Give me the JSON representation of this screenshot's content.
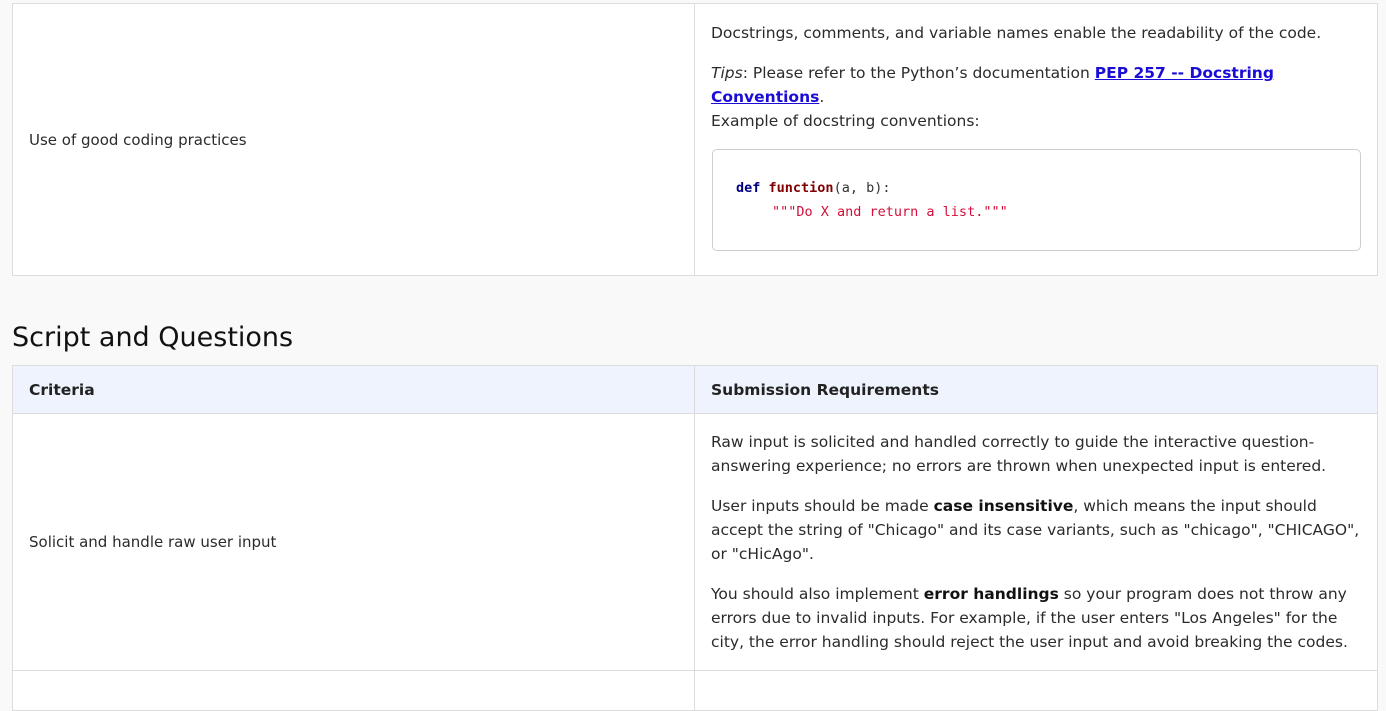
{
  "top_table": {
    "row": {
      "criteria": "Use of good coding practices",
      "req_p1": "Docstrings, comments, and variable names enable the readability of the code.",
      "tips_label": "Tips",
      "tips_text": ": Please refer to the Python’s documentation ",
      "tips_link": "PEP 257 -- Docstring Conventions",
      "tips_end": ".",
      "example_text": "Example of docstring conventions:",
      "code": {
        "def_kw": "def",
        "func_name": "function",
        "params": "(a, b):",
        "docstring": "\"\"\"Do X and return a list.\"\"\""
      }
    }
  },
  "section": {
    "title": "Script and Questions"
  },
  "script_table": {
    "headers": {
      "criteria": "Criteria",
      "requirements": "Submission Requirements"
    },
    "row": {
      "criteria": "Solicit and handle raw user input",
      "p1": "Raw input is solicited and handled correctly to guide the interactive question-answering experience; no errors are thrown when unexpected input is entered.",
      "p2_a": "User inputs should be made ",
      "p2_b": "case insensitive",
      "p2_c": ", which means the input should accept the string of \"Chicago\" and its case variants, such as \"chicago\", \"CHICAGO\", or \"cHicAgo\".",
      "p3_a": "You should also implement ",
      "p3_b": "error handlings",
      "p3_c": " so your program does not throw any errors due to invalid inputs. For example, if the user enters \"Los Angeles\" for the city, the error handling should reject the user input and avoid breaking the codes."
    }
  }
}
